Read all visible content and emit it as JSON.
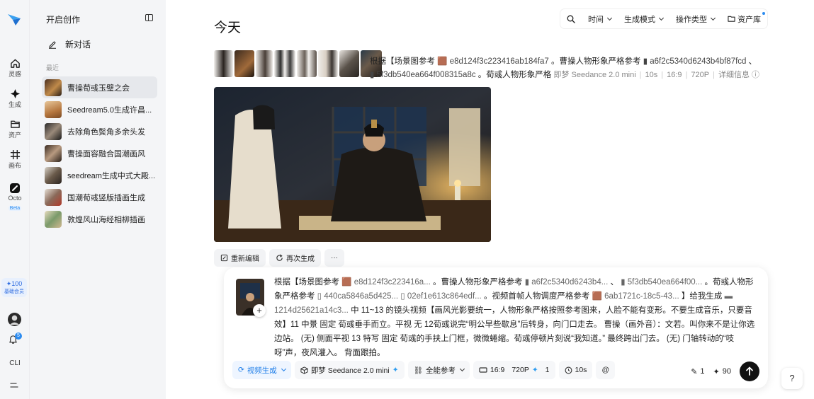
{
  "rail": {
    "items": [
      {
        "label": "灵感",
        "icon": "home-icon"
      },
      {
        "label": "生成",
        "icon": "sparkle-icon"
      },
      {
        "label": "资产",
        "icon": "folder-icon"
      },
      {
        "label": "画布",
        "icon": "canvas-icon"
      },
      {
        "label": "Octo",
        "icon": "octo-icon",
        "badge": "Beta"
      }
    ],
    "credits": "✦100",
    "membership": "基础会员",
    "notification_count": "5",
    "cli_label": "CLI"
  },
  "sidebar": {
    "title": "开启创作",
    "new_chat": "新对话",
    "section_label": "最近",
    "items": [
      {
        "label": "曹操荀彧玉璧之会"
      },
      {
        "label": "Seedream5.0生成许昌..."
      },
      {
        "label": "去除角色鬓角多余头发"
      },
      {
        "label": "曹操面容融合国潮画风"
      },
      {
        "label": "seedream生成中式大殿..."
      },
      {
        "label": "国潮荀彧竖版插画生成"
      },
      {
        "label": "敦煌风山海经相柳插画"
      }
    ]
  },
  "header": {
    "title": "今天",
    "time_filter": "时间",
    "mode_filter": "生成模式",
    "op_filter": "操作类型",
    "assets": "资产库"
  },
  "record": {
    "prompt_prefix": "根据【场景图参考",
    "ref1": "e8d124f3c223416ab184fa7",
    "mid1": "。曹操人物形象严格参考",
    "ref2": "a6f2c5340d6243b4bf87fcd",
    "mid2": "、",
    "ref3": "5f3db540ea664f008315a8c",
    "mid3": "。荀彧人物形象严格",
    "model": "即梦 Seedance 2.0 mini",
    "duration": "10s",
    "ratio": "16:9",
    "resolution": "720P",
    "details": "详细信息"
  },
  "actions": {
    "edit": "重新编辑",
    "regenerate": "再次生成",
    "more": "···"
  },
  "composer": {
    "t1": "根据【场景图参考",
    "c1": "e8d124f3c223416a...",
    "t2": "。曹操人物形象严格参考",
    "c2": "a6f2c5340d6243b4...",
    "t3": "、",
    "c3": "5f3db540ea664f00...",
    "t4": "。荀彧人物形象严格参考",
    "c4": "440ca5846a5d425...",
    "c5": "02ef1e613c864edf...",
    "t5": "。视频首帧人物调度严格参考",
    "c6": "6ab1721c-18c5-43...",
    "t6": "】给我生成",
    "c7": "1214d25621a14c3...",
    "t7": "中 11~13 的镜头视频【画风光影要统一，人物形象严格按照参考图来，人脸不能有变形。不要生成音乐，只要音效】11 中景 固定 荀彧垂手而立。平视 无 12荀彧说完“明公早些歇息”后转身，向门口走去。 曹操（画外音）：文若。叫你来不是让你选边站。 (无) 侧面平视 13 特写 固定 荀彧的手扶上门框，微微蜷缩。荀彧停顿片刻说“我知道。” 最终跨出门去。 (无) 门轴转动的“吱呀”声，夜风灌入。 背面跟拍。",
    "mode": "视频生成",
    "model": "即梦 Seedance 2.0 mini",
    "ref_mode": "全能参考",
    "ratio": "16:9",
    "resolution": "720P",
    "count": "1",
    "duration": "10s",
    "mention": "@",
    "variants": "1",
    "cost": "90"
  },
  "help": "?"
}
